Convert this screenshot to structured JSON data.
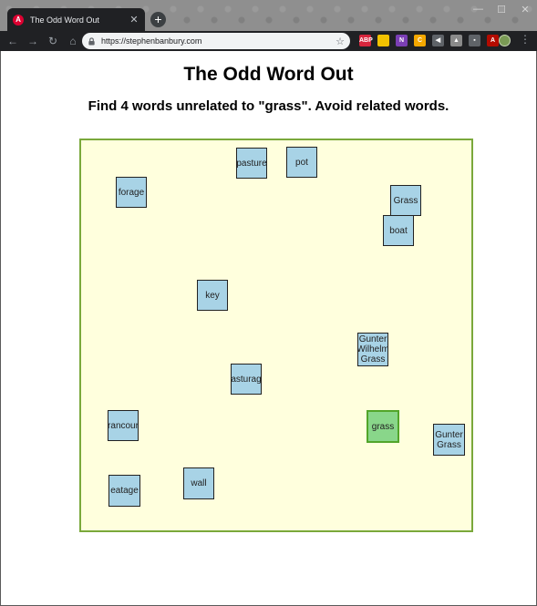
{
  "browser": {
    "tab_title": "The Odd Word Out",
    "favicon_letter": "A",
    "url": "https://stephenbanbury.com",
    "new_tab_label": "+",
    "tab_close_label": "✕",
    "nav": {
      "back": "←",
      "forward": "→",
      "reload": "↻",
      "home": "⌂"
    },
    "star": "☆",
    "menu": "⋮",
    "window_controls": {
      "minimize": "—",
      "maximize": "☐",
      "close": "✕"
    },
    "extensions": [
      {
        "name": "abp-icon",
        "label": "ABP",
        "color": "#d7263d"
      },
      {
        "name": "notes-icon",
        "label": "",
        "color": "#f2c200"
      },
      {
        "name": "onenote-icon",
        "label": "N",
        "color": "#7b3fb5"
      },
      {
        "name": "honey-icon",
        "label": "C",
        "color": "#f5a800"
      },
      {
        "name": "feedback-icon",
        "label": "◀",
        "color": "#5f6368"
      },
      {
        "name": "drive-icon",
        "label": "▲",
        "color": "#8a8a8a"
      },
      {
        "name": "image-icon",
        "label": "▪",
        "color": "#5f6368"
      },
      {
        "name": "acrobat-icon",
        "label": "A",
        "color": "#b30b00"
      }
    ]
  },
  "page": {
    "title": "The Odd Word Out",
    "subtitle": "Find 4 words unrelated to \"grass\". Avoid related words."
  },
  "board": {
    "colors": {
      "background": "#ffffdd",
      "border": "#7aa83b",
      "tile": "#a8d3e6",
      "selected_tile": "#89d68a"
    },
    "words": [
      {
        "text": "pasture",
        "selected": false
      },
      {
        "text": "pot",
        "selected": false
      },
      {
        "text": "forage",
        "selected": false
      },
      {
        "text": "Grass",
        "selected": false
      },
      {
        "text": "boat",
        "selected": false
      },
      {
        "text": "key",
        "selected": false
      },
      {
        "text": "Gunter Wilhelm Grass",
        "selected": false
      },
      {
        "text": "pasturage",
        "selected": false
      },
      {
        "text": "grass",
        "selected": true
      },
      {
        "text": "rancour",
        "selected": false
      },
      {
        "text": "Gunter Grass",
        "selected": false
      },
      {
        "text": "eatage",
        "selected": false
      },
      {
        "text": "wall",
        "selected": false
      }
    ]
  }
}
